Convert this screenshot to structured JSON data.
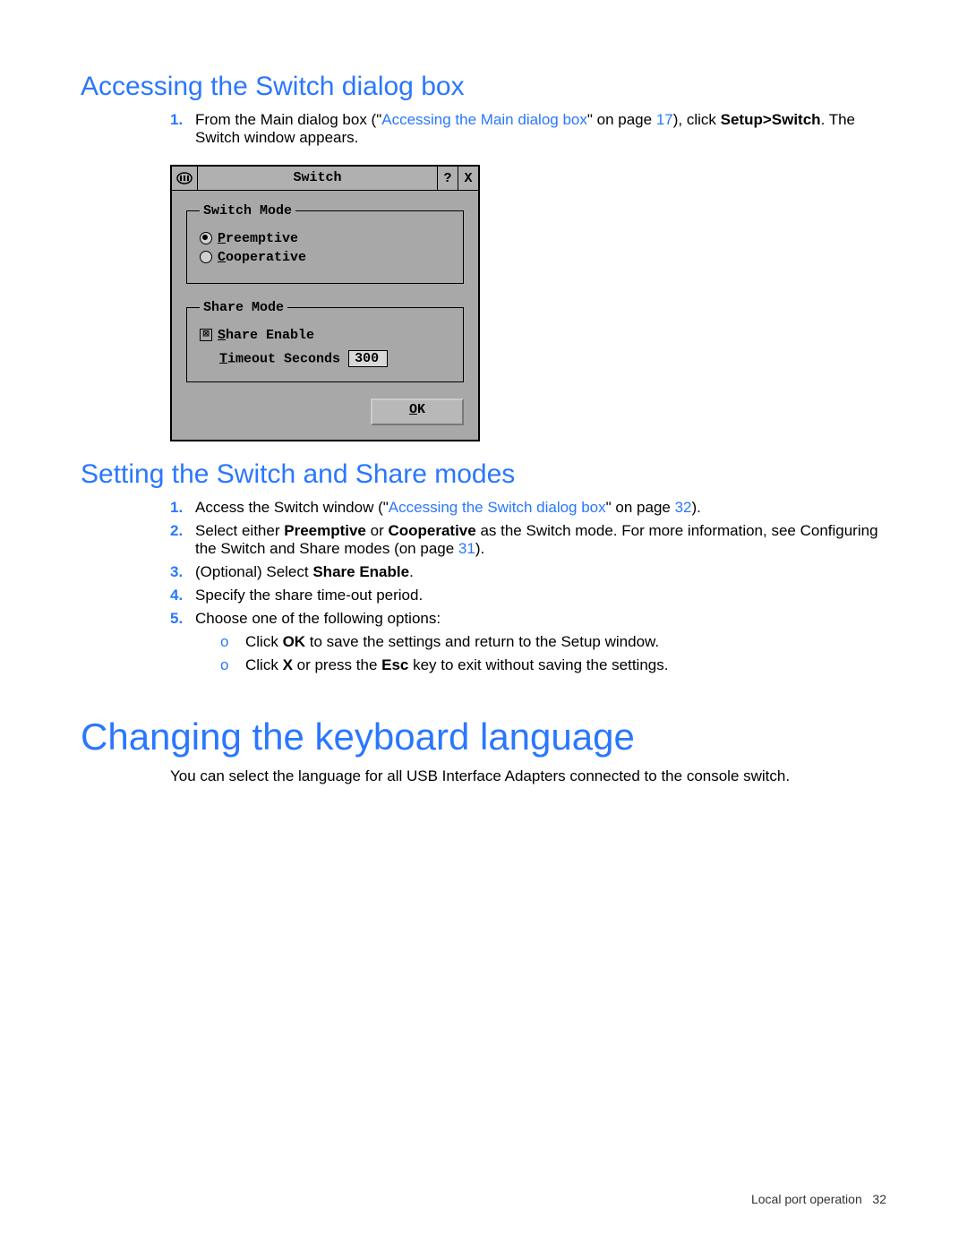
{
  "section1": {
    "heading": "Accessing the Switch dialog box",
    "step1_pre": "From the Main dialog box (\"",
    "step1_link": "Accessing the Main dialog box",
    "step1_mid": "\" on page ",
    "step1_page": "17",
    "step1_after": "), click ",
    "step1_bold": "Setup>Switch",
    "step1_end": ". The Switch window appears."
  },
  "dialog": {
    "title": "Switch",
    "help": "?",
    "close": "X",
    "switch_mode_legend": "Switch Mode",
    "radio_preemptive_u": "P",
    "radio_preemptive_rest": "reemptive",
    "radio_cooperative_u": "C",
    "radio_cooperative_rest": "ooperative",
    "share_mode_legend": "Share Mode",
    "share_enable_u": "S",
    "share_enable_rest": "hare Enable",
    "check_mark": "⊠",
    "timeout_u": "T",
    "timeout_rest": "imeout Seconds",
    "timeout_value": "300",
    "ok_u": "O",
    "ok_rest": "K"
  },
  "section2": {
    "heading": "Setting the Switch and Share modes",
    "s1_pre": "Access the Switch window (\"",
    "s1_link": "Accessing the Switch dialog box",
    "s1_mid": "\" on page ",
    "s1_page": "32",
    "s1_end": ").",
    "s2_a": "Select either ",
    "s2_b1": "Preemptive",
    "s2_b": " or ",
    "s2_b2": "Cooperative",
    "s2_c": " as the Switch mode. For more information, see Configuring the Switch and Share modes (on page ",
    "s2_page": "31",
    "s2_end": ").",
    "s3_a": "(Optional) Select ",
    "s3_b": "Share Enable",
    "s3_c": ".",
    "s4": "Specify the share time-out period.",
    "s5": "Choose one of the following options:",
    "s5a_a": "Click ",
    "s5a_b": "OK",
    "s5a_c": " to save the settings and return to the Setup window.",
    "s5b_a": "Click ",
    "s5b_b": "X",
    "s5b_c": " or press the ",
    "s5b_d": "Esc",
    "s5b_e": " key to exit without saving the settings."
  },
  "section3": {
    "heading": "Changing the keyboard language",
    "para": "You can select the language for all USB Interface Adapters connected to the console switch."
  },
  "footer": {
    "text": "Local port operation",
    "page": "32"
  }
}
